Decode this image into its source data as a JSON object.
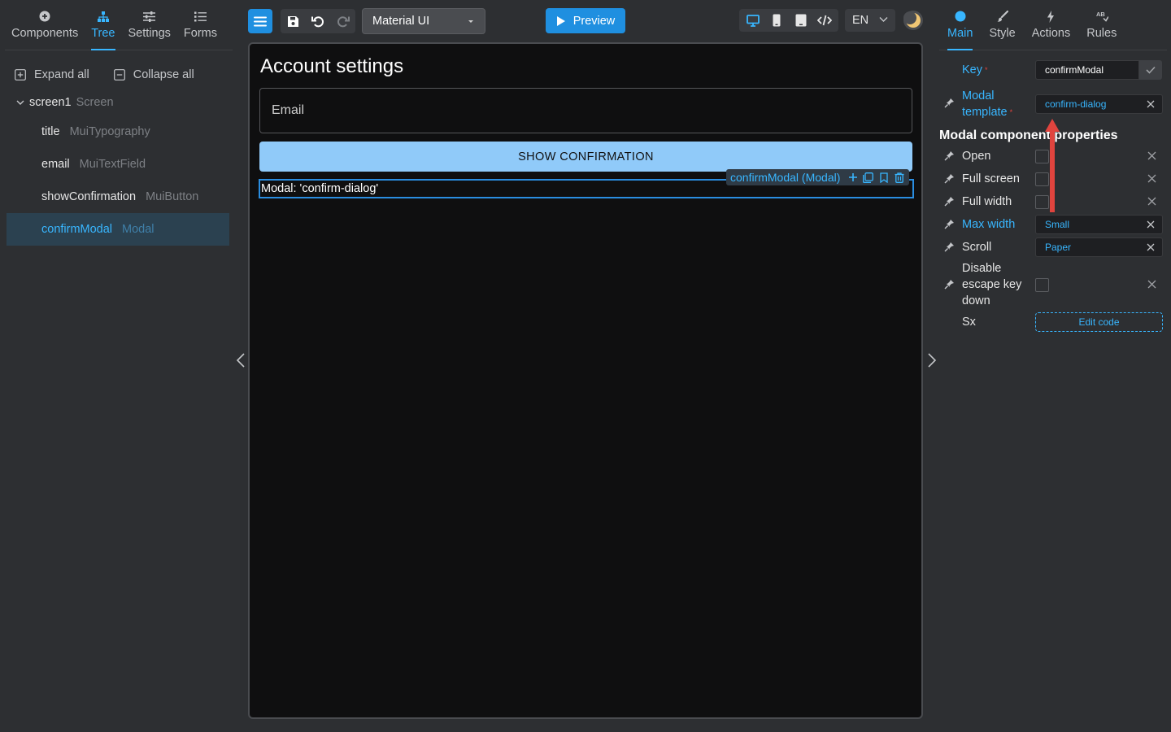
{
  "left_panel": {
    "tabs": [
      {
        "label": "Components",
        "icon": "plus-circle-icon"
      },
      {
        "label": "Tree",
        "icon": "tree-icon"
      },
      {
        "label": "Settings",
        "icon": "sliders-icon"
      },
      {
        "label": "Forms",
        "icon": "list-icon"
      }
    ],
    "active_tab": "Tree",
    "expand_all": "Expand all",
    "collapse_all": "Collapse all",
    "tree": {
      "root": {
        "name": "screen1",
        "type": "Screen"
      },
      "items": [
        {
          "name": "title",
          "type": "MuiTypography"
        },
        {
          "name": "email",
          "type": "MuiTextField"
        },
        {
          "name": "showConfirmation",
          "type": "MuiButton"
        },
        {
          "name": "confirmModal",
          "type": "Modal",
          "selected": true
        }
      ]
    }
  },
  "toolbar": {
    "framework": "Material UI",
    "preview_label": "Preview",
    "language": "EN"
  },
  "canvas": {
    "title": "Account settings",
    "email_label": "Email",
    "button_label": "SHOW CONFIRMATION",
    "modal_placeholder": "Modal: 'confirm-dialog'",
    "component_toolbar_label": "confirmModal (Modal)"
  },
  "right_panel": {
    "tabs": [
      {
        "label": "Main",
        "icon": "circle-icon"
      },
      {
        "label": "Style",
        "icon": "brush-icon"
      },
      {
        "label": "Actions",
        "icon": "lightning-icon"
      },
      {
        "label": "Rules",
        "icon": "ab-icon"
      }
    ],
    "active_tab": "Main",
    "key_label": "Key",
    "key_value": "confirmModal",
    "modal_template_label_1": "Modal",
    "modal_template_label_2": "template",
    "modal_template_value": "confirm-dialog",
    "section_title": "Modal component properties",
    "props": {
      "open": "Open",
      "full_screen": "Full screen",
      "full_width": "Full width",
      "max_width": "Max width",
      "max_width_value": "Small",
      "scroll": "Scroll",
      "scroll_value": "Paper",
      "disable_escape_1": "Disable",
      "disable_escape_2": "escape key",
      "disable_escape_3": "down",
      "sx": "Sx",
      "edit_code": "Edit code"
    }
  },
  "colors": {
    "accent": "#38b6ff",
    "primary_button": "#1f8fe0",
    "canvas_button": "#90caf9",
    "annotation_arrow": "#e0443e",
    "selected_row": "#2b4150"
  }
}
